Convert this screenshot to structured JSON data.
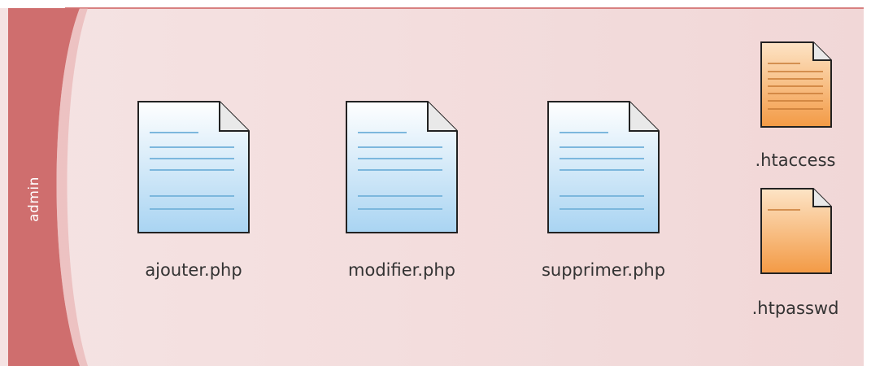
{
  "folder": {
    "label": "admin"
  },
  "files": [
    {
      "name": "ajouter.php",
      "icon": "php-file-icon"
    },
    {
      "name": "modifier.php",
      "icon": "php-file-icon"
    },
    {
      "name": "supprimer.php",
      "icon": "php-file-icon"
    },
    {
      "name": ".htaccess",
      "icon": "config-file-icon"
    },
    {
      "name": ".htpasswd",
      "icon": "config-file-icon"
    }
  ],
  "colors": {
    "folder_band": "#cf6e6e",
    "folder_body": "#f2dcdc",
    "php_file": "#bfe0f5",
    "config_file": "#f5b06a"
  }
}
